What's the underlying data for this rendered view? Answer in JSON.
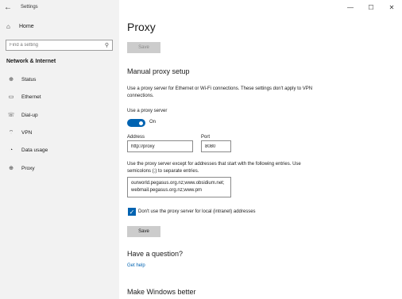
{
  "window": {
    "app_title": "Settings",
    "back_glyph": "←",
    "minimize_glyph": "—",
    "maximize_glyph": "☐",
    "close_glyph": "✕"
  },
  "sidebar": {
    "home": {
      "label": "Home",
      "icon": "home-icon",
      "glyph": "⌂"
    },
    "search": {
      "placeholder": "Find a setting",
      "icon": "search-icon",
      "glyph": "⚲"
    },
    "section_title": "Network & Internet",
    "items": [
      {
        "label": "Status",
        "icon": "globe-icon",
        "glyph": "⊕"
      },
      {
        "label": "Ethernet",
        "icon": "ethernet-icon",
        "glyph": "▭"
      },
      {
        "label": "Dial-up",
        "icon": "dialup-icon",
        "glyph": "☏"
      },
      {
        "label": "VPN",
        "icon": "vpn-icon",
        "glyph": "⌔"
      },
      {
        "label": "Data usage",
        "icon": "data-usage-icon",
        "glyph": "◔"
      },
      {
        "label": "Proxy",
        "icon": "proxy-globe-icon",
        "glyph": "⊕"
      }
    ]
  },
  "main": {
    "title": "Proxy",
    "top_save_label": "Save",
    "manual_heading": "Manual proxy setup",
    "description": "Use a proxy server for Ethernet or Wi-Fi connections. These settings don't apply to VPN connections.",
    "use_proxy_label": "Use a proxy server",
    "toggle_state": "On",
    "address_label": "Address",
    "address_value": "http://proxy",
    "port_label": "Port",
    "port_value": "8080",
    "exceptions_description": "Use the proxy server except for addresses that start with the following entries. Use semicolons (;) to separate entries.",
    "exceptions_value": "ourworld.pegasus.org.nz;www.obsidium.net;webmail.pegasus.org.nz;www.pm",
    "local_checkbox_label": "Don't use the proxy server for local (intranet) addresses",
    "save_label": "Save",
    "question_heading": "Have a question?",
    "get_help_label": "Get help",
    "better_heading": "Make Windows better"
  },
  "colors": {
    "accent": "#0063b1",
    "sidebar_bg": "#f2f2f2",
    "button_bg": "#cccccc"
  }
}
